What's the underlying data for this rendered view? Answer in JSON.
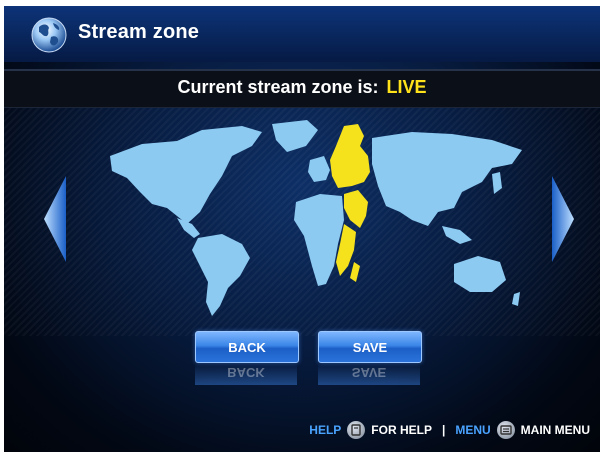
{
  "header": {
    "title": "Stream zone",
    "icon": "globe-icon"
  },
  "zone": {
    "label": "Current stream zone is:",
    "value": "LIVE",
    "value_color": "#ffe21a"
  },
  "map": {
    "land_color": "#8ccaf2",
    "highlight_color": "#f5e11c",
    "highlighted_zone": "Europe / Africa (east)"
  },
  "nav": {
    "left_icon": "arrow-left-icon",
    "right_icon": "arrow-right-icon"
  },
  "buttons": {
    "back_label": "BACK",
    "save_label": "SAVE"
  },
  "footer": {
    "help_key": "HELP",
    "help_text": "FOR HELP",
    "separator": "|",
    "menu_key": "MENU",
    "menu_text": "MAIN MENU",
    "key_color": "#4aa3ff"
  }
}
